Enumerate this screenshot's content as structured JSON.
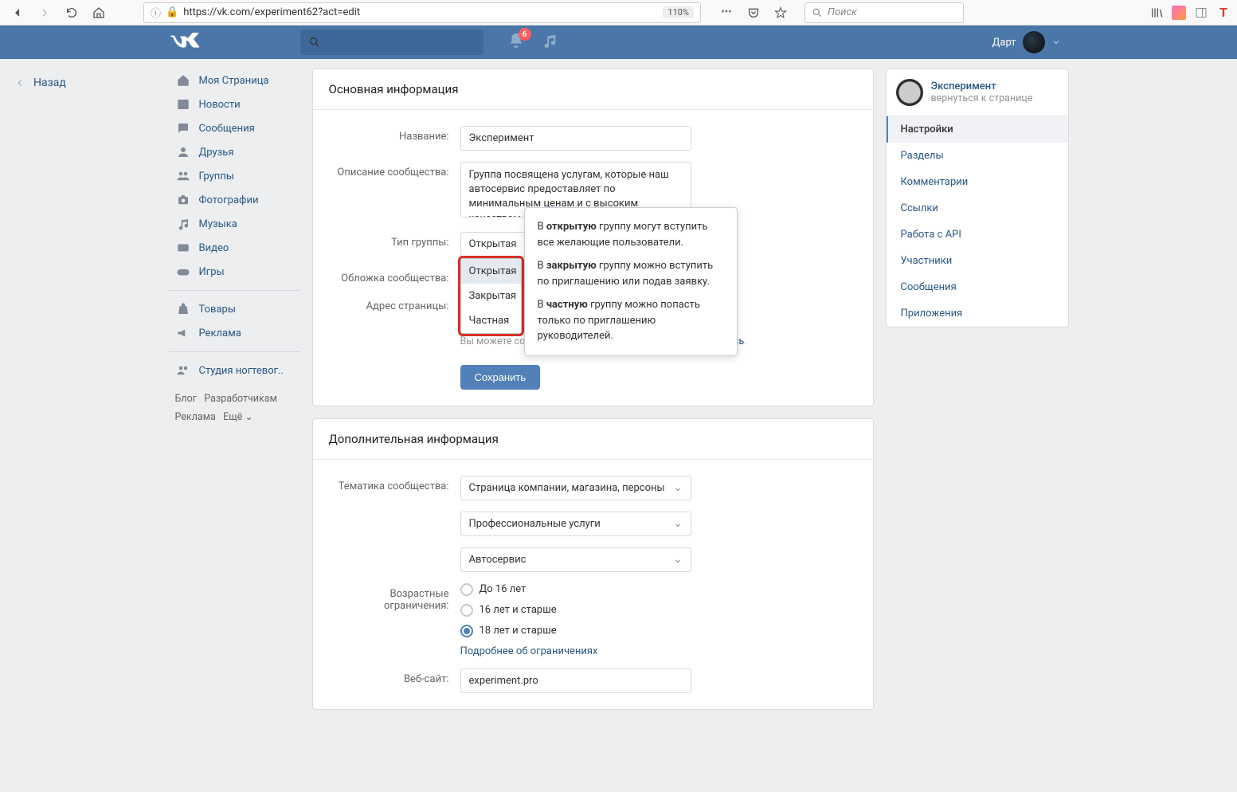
{
  "browser": {
    "url": "https://vk.com/experiment62?act=edit",
    "zoom": "110%",
    "search_placeholder": "Поиск"
  },
  "header": {
    "notification_count": "6",
    "username": "Дарт"
  },
  "back_label": "Назад",
  "nav": {
    "items": [
      {
        "label": "Моя Страница"
      },
      {
        "label": "Новости"
      },
      {
        "label": "Сообщения"
      },
      {
        "label": "Друзья"
      },
      {
        "label": "Группы"
      },
      {
        "label": "Фотографии"
      },
      {
        "label": "Музыка"
      },
      {
        "label": "Видео"
      },
      {
        "label": "Игры"
      }
    ],
    "items2": [
      {
        "label": "Товары"
      },
      {
        "label": "Реклама"
      }
    ],
    "items3": [
      {
        "label": "Студия ногтевог.."
      }
    ],
    "footer": {
      "blog": "Блог",
      "dev": "Разработчикам",
      "ads": "Реклама",
      "more": "Ещё"
    }
  },
  "main": {
    "section1_title": "Основная информация",
    "name_label": "Название:",
    "name_value": "Эксперимент",
    "desc_label": "Описание сообщества:",
    "desc_value": "Группа посвящена услугам, которые наш автосервис предоставляет по минимальным ценам и с высоким качеством обслуживания.",
    "type_label": "Тип группы:",
    "type_value": "Открытая",
    "type_options": [
      "Открытая",
      "Закрытая",
      "Частная"
    ],
    "cover_label": "Обложка сообщества:",
    "address_label": "Адрес страницы:",
    "sticker_hint_1": "Вы можете создать наклейки для Вашего сообщества ",
    "sticker_hint_link": "здесь",
    "save_btn": "Сохранить",
    "section2_title": "Дополнительная информация",
    "theme_label": "Тематика сообщества:",
    "theme_value": "Страница компании, магазина, персоны",
    "theme_sub1": "Профессиональные  услуги",
    "theme_sub2": "Автосервис",
    "age_label": "Возрастные ограничения:",
    "age_options": [
      "До 16 лет",
      "16 лет и старше",
      "18 лет и старше"
    ],
    "age_more": "Подробнее об ограничениях",
    "website_label": "Веб-сайт:",
    "website_value": "experiment.pro"
  },
  "tooltip": {
    "p1a": "В ",
    "p1b": "открытую",
    "p1c": " группу могут вступить все желающие пользователи.",
    "p2a": "В ",
    "p2b": "закрытую",
    "p2c": " группу можно вступить по приглашению или подав заявку.",
    "p3a": "В ",
    "p3b": "частную",
    "p3c": " группу можно попасть только по приглашению руководителей."
  },
  "right": {
    "title": "Эксперимент",
    "subtitle": "вернуться к странице",
    "items": [
      {
        "label": "Настройки",
        "active": true
      },
      {
        "label": "Разделы"
      },
      {
        "label": "Комментарии"
      },
      {
        "label": "Ссылки"
      },
      {
        "label": "Работа с API"
      },
      {
        "label": "Участники"
      },
      {
        "label": "Сообщения"
      },
      {
        "label": "Приложения"
      }
    ]
  }
}
